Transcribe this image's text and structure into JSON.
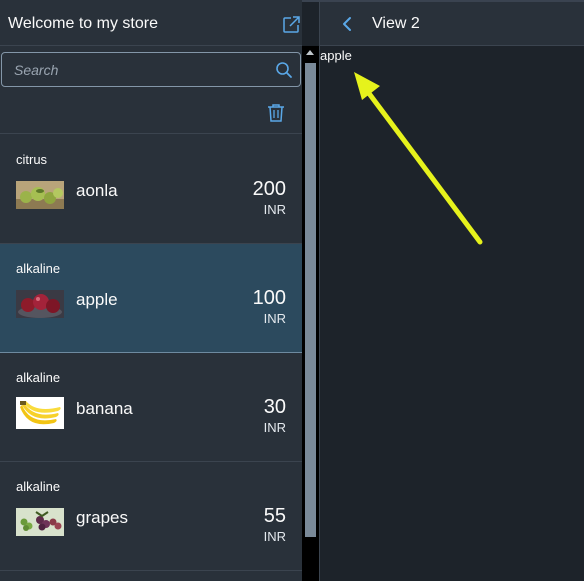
{
  "master": {
    "title": "Welcome to my store",
    "search": {
      "placeholder": "Search",
      "value": ""
    },
    "items": [
      {
        "category": "citrus",
        "name": "aonla",
        "price": "200",
        "unit": "INR",
        "thumb": "aonla-image"
      },
      {
        "category": "alkaline",
        "name": "apple",
        "price": "100",
        "unit": "INR",
        "thumb": "apple-image"
      },
      {
        "category": "alkaline",
        "name": "banana",
        "price": "30",
        "unit": "INR",
        "thumb": "banana-image"
      },
      {
        "category": "alkaline",
        "name": "grapes",
        "price": "55",
        "unit": "INR",
        "thumb": "grapes-image"
      }
    ],
    "selected_item": "apple"
  },
  "detail": {
    "title": "View 2",
    "text": "apple"
  },
  "icons": {
    "share": "share-icon",
    "search": "search-icon",
    "delete": "trash-icon",
    "back": "back-chevron-icon"
  },
  "colors": {
    "accent": "#5aa8e8",
    "selected_row": "#2c4a5e",
    "annotation_arrow": "#e6f21c"
  }
}
